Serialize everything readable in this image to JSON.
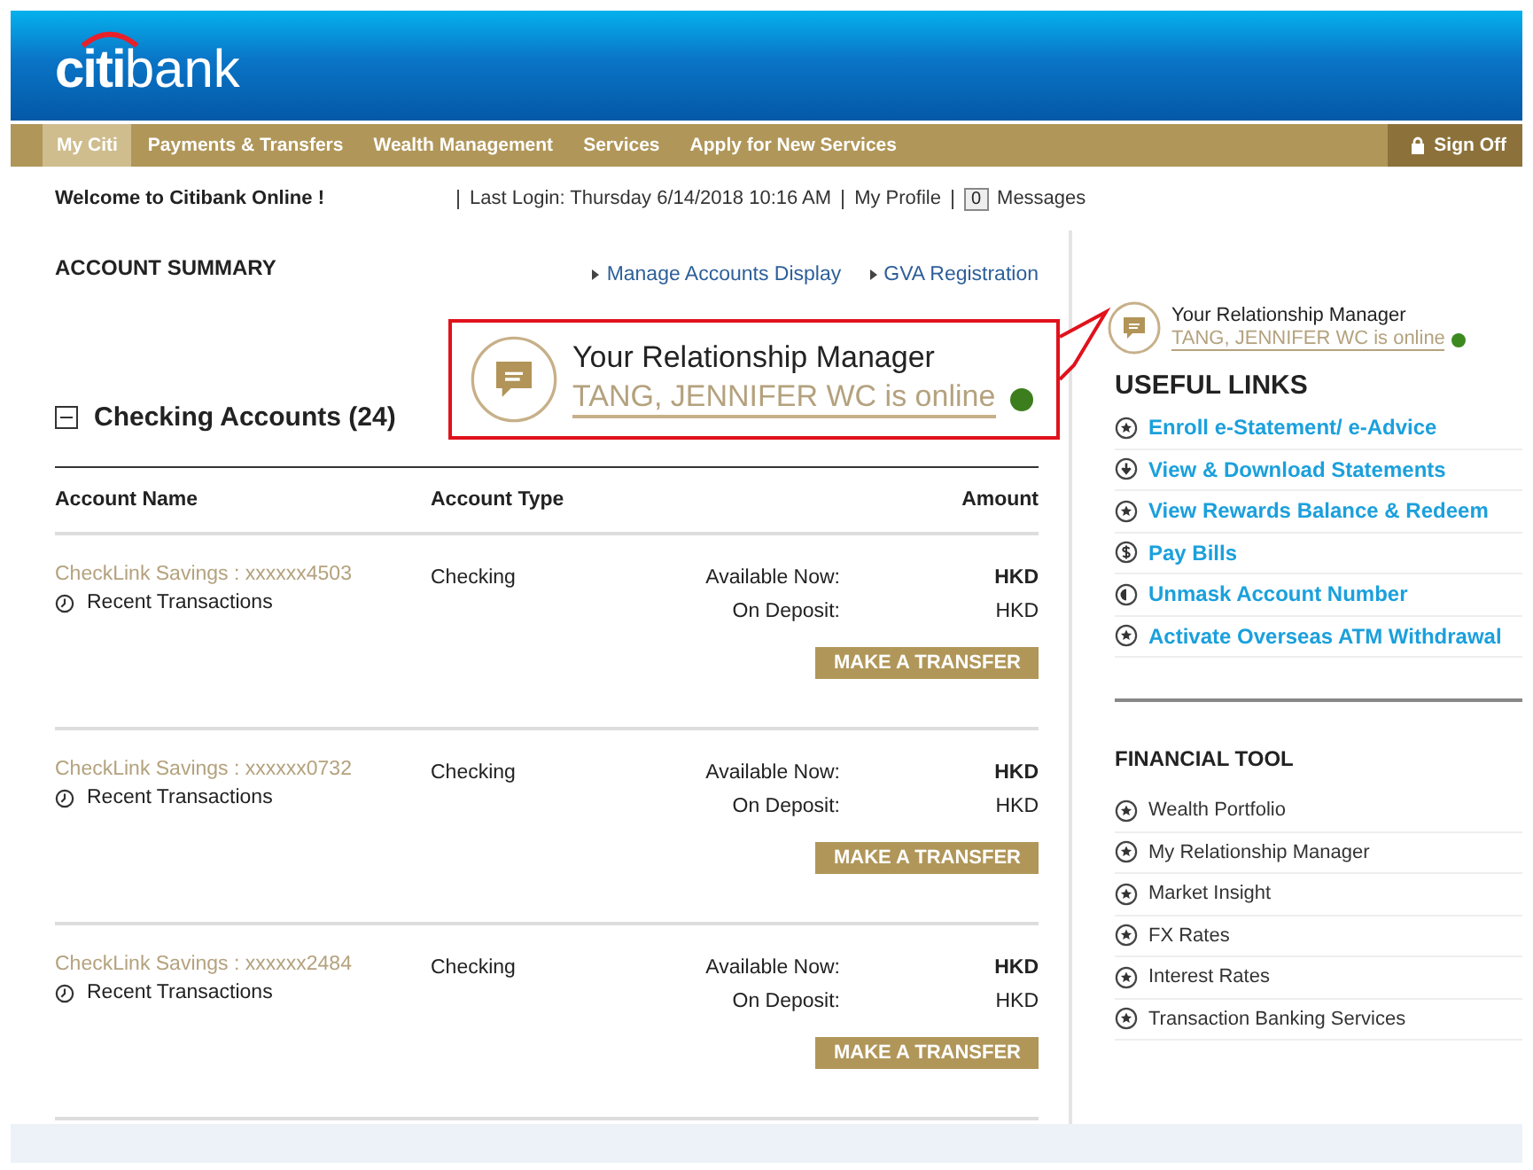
{
  "logo": {
    "brand": "citi",
    "suffix": "bank"
  },
  "nav": {
    "items": [
      {
        "label": "My Citi",
        "selected": true
      },
      {
        "label": "Payments & Transfers",
        "selected": false
      },
      {
        "label": "Wealth Management",
        "selected": false
      },
      {
        "label": "Services",
        "selected": false
      },
      {
        "label": "Apply for New Services",
        "selected": false
      }
    ],
    "sign_off": "Sign Off"
  },
  "welcome": {
    "greeting": "Welcome to Citibank Online !",
    "last_login": "Last Login: Thursday 6/14/2018 10:16 AM",
    "profile": "My Profile",
    "message_count": "0",
    "messages": "Messages"
  },
  "summary": {
    "title": "ACCOUNT SUMMARY",
    "links": [
      "Manage Accounts Display",
      "GVA Registration"
    ],
    "section": {
      "title": "Checking Accounts (24)",
      "expanded": true
    },
    "columns": [
      "Account Name",
      "Account Type",
      "Amount"
    ],
    "accounts": [
      {
        "name": "CheckLink Savings : xxxxxx4503",
        "recent": "Recent Transactions",
        "type": "Checking",
        "available_label": "Available Now:",
        "available": "HKD",
        "deposit_label": "On Deposit:",
        "deposit": "HKD",
        "button": "MAKE A TRANSFER"
      },
      {
        "name": "CheckLink Savings : xxxxxx0732",
        "recent": "Recent Transactions",
        "type": "Checking",
        "available_label": "Available Now:",
        "available": "HKD",
        "deposit_label": "On Deposit:",
        "deposit": "HKD",
        "button": "MAKE A TRANSFER"
      },
      {
        "name": "CheckLink Savings : xxxxxx2484",
        "recent": "Recent Transactions",
        "type": "Checking",
        "available_label": "Available Now:",
        "available": "HKD",
        "deposit_label": "On Deposit:",
        "deposit": "HKD",
        "button": "MAKE A TRANSFER"
      }
    ]
  },
  "callout": {
    "title": "Your Relationship Manager",
    "status": "TANG, JENNIFER WC is online",
    "online": true
  },
  "manager": {
    "title": "Your Relationship Manager",
    "status": "TANG, JENNIFER WC is online",
    "online": true
  },
  "useful_links": {
    "title": "USEFUL LINKS",
    "items": [
      {
        "label": "Enroll e-Statement/ e-Advice",
        "kind": "star"
      },
      {
        "label": "View & Download Statements",
        "kind": "download"
      },
      {
        "label": "View Rewards Balance & Redeem",
        "kind": "star"
      },
      {
        "label": "Pay Bills",
        "kind": "dollar"
      },
      {
        "label": "Unmask Account Number",
        "kind": "contrast"
      },
      {
        "label": "Activate Overseas ATM Withdrawal",
        "kind": "star"
      }
    ]
  },
  "financial_tool": {
    "title": "FINANCIAL TOOL",
    "items": [
      {
        "label": "Wealth Portfolio",
        "kind": "star"
      },
      {
        "label": "My Relationship Manager",
        "kind": "star"
      },
      {
        "label": "Market Insight",
        "kind": "star"
      },
      {
        "label": "FX Rates",
        "kind": "star"
      },
      {
        "label": "Interest Rates",
        "kind": "star"
      },
      {
        "label": "Transaction Banking Services",
        "kind": "star"
      }
    ]
  }
}
